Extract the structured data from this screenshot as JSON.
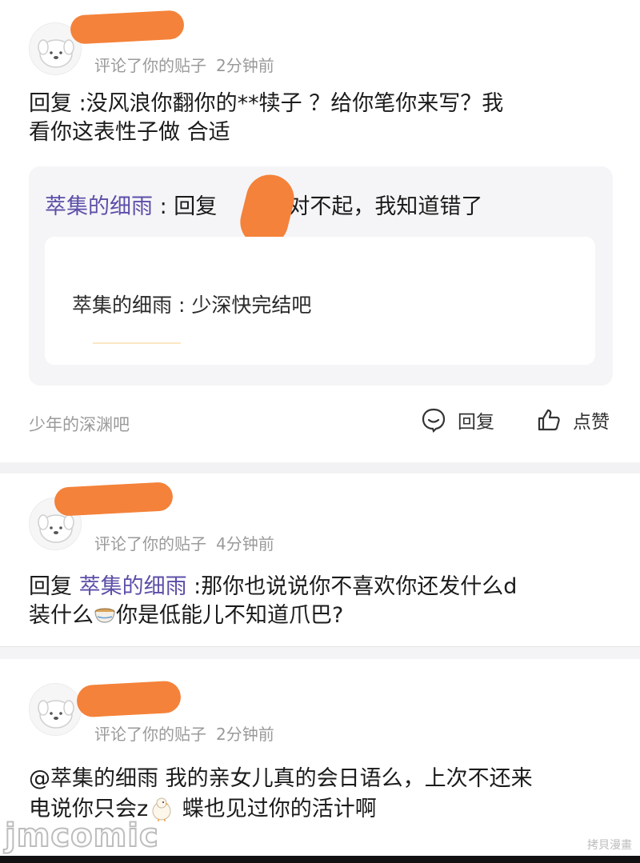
{
  "comments": [
    {
      "meta_action": "评论了你的贴子",
      "meta_time": "2分钟前",
      "body_line1": "回复  :没风浪你翻你的**犊子    ？给你笔你来写？我",
      "body_line2": "看你这表性子做    合适",
      "quote": {
        "user": "萃集的细雨",
        "reply_prefix": " : 回复",
        "reply_text": ":对不起，我知道错了",
        "inner_user": "萃集的细雨",
        "inner_text": " : 少深快完结吧"
      },
      "footer_user": "少年的深渊吧",
      "reply_label": "回复",
      "like_label": "点赞"
    },
    {
      "meta_action": "评论了你的贴子",
      "meta_time": "4分钟前",
      "body_prefix": "回复 ",
      "body_mention": "萃集的细雨",
      "body_rest": "  :那你也说说你不喜欢你还发什么d",
      "body_line2a": "装什么",
      "body_line2b": "你是低能儿不知道爪巴?"
    },
    {
      "meta_action": "评论了你的贴子",
      "meta_time": "2分钟前",
      "body_line1": "@萃集的细雨 我的亲女儿真的会日语么，上次不还来",
      "body_line2a": "电说你只会z",
      "body_line2b": " 蝶也见过你的活计啊"
    }
  ],
  "watermark": {
    "brand": "jmcomic",
    "tag": "拷貝漫畫"
  },
  "colors": {
    "mention": "#5b4fa8",
    "redaction": "#f4823a",
    "meta_gray": "#9a9a9a"
  }
}
